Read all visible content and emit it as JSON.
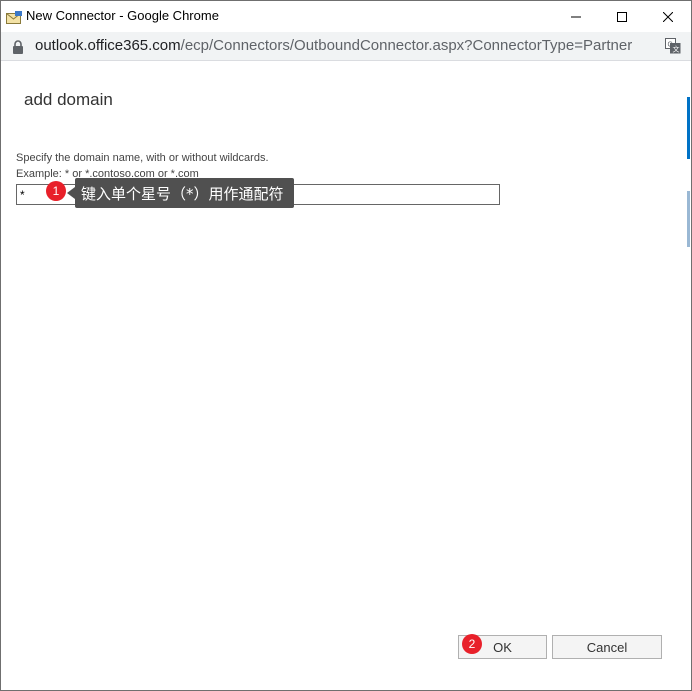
{
  "window": {
    "title": "New Connector - Google Chrome",
    "controls": [
      "minimize-icon",
      "maximize-icon",
      "close-icon"
    ]
  },
  "address_bar": {
    "url_host": "outlook.office365.com",
    "url_path": "/ecp/Connectors/OutboundConnector.aspx?ConnectorType=Partner",
    "icons": [
      "lock-icon",
      "translate-icon"
    ]
  },
  "dialog": {
    "title": "add domain",
    "instruction_line1": "Specify the domain name, with or without wildcards.",
    "instruction_line2": "Example: * or *.contoso.com or *.com",
    "domain_value": "*",
    "ok_label": "OK",
    "cancel_label": "Cancel"
  },
  "annotations": {
    "step1_number": "1",
    "step1_text": "键入单个星号（*）用作通配符",
    "step2_number": "2",
    "badge_color": "#e8202a"
  }
}
